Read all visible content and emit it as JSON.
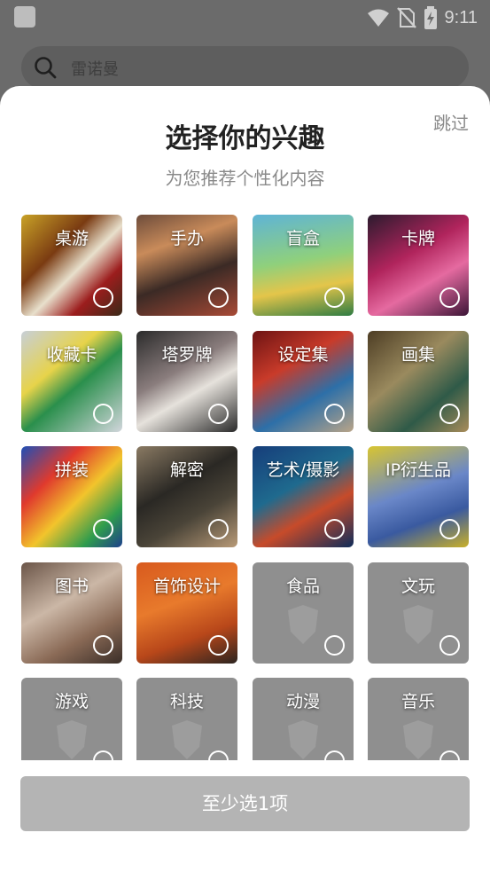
{
  "status_bar": {
    "time": "9:11",
    "icons": [
      "wifi-icon",
      "no-sim-icon",
      "battery-charging-icon"
    ]
  },
  "search": {
    "placeholder": "雷诺曼",
    "icon": "search-icon"
  },
  "sheet": {
    "title": "选择你的兴趣",
    "subtitle": "为您推荐个性化内容",
    "skip_label": "跳过",
    "submit_label": "至少选1项"
  },
  "interests": [
    {
      "label": "桌游",
      "has_image": true,
      "selected": false
    },
    {
      "label": "手办",
      "has_image": true,
      "selected": false
    },
    {
      "label": "盲盒",
      "has_image": true,
      "selected": false
    },
    {
      "label": "卡牌",
      "has_image": true,
      "selected": false
    },
    {
      "label": "收藏卡",
      "has_image": true,
      "selected": false
    },
    {
      "label": "塔罗牌",
      "has_image": true,
      "selected": false
    },
    {
      "label": "设定集",
      "has_image": true,
      "selected": false
    },
    {
      "label": "画集",
      "has_image": true,
      "selected": false
    },
    {
      "label": "拼装",
      "has_image": true,
      "selected": false
    },
    {
      "label": "解密",
      "has_image": true,
      "selected": false
    },
    {
      "label": "艺术/摄影",
      "has_image": true,
      "selected": false
    },
    {
      "label": "IP衍生品",
      "has_image": true,
      "selected": false
    },
    {
      "label": "图书",
      "has_image": true,
      "selected": false
    },
    {
      "label": "首饰设计",
      "has_image": true,
      "selected": false
    },
    {
      "label": "食品",
      "has_image": false,
      "selected": false
    },
    {
      "label": "文玩",
      "has_image": false,
      "selected": false
    },
    {
      "label": "游戏",
      "has_image": false,
      "selected": false
    },
    {
      "label": "科技",
      "has_image": false,
      "selected": false
    },
    {
      "label": "动漫",
      "has_image": false,
      "selected": false
    },
    {
      "label": "音乐",
      "has_image": false,
      "selected": false
    }
  ],
  "colors": {
    "overlay": "#6b6b6b",
    "placeholder_tile": "#8f8f8f",
    "submit_disabled": "#b4b4b4"
  }
}
